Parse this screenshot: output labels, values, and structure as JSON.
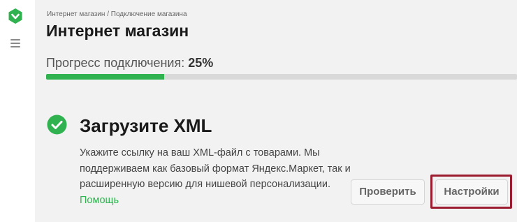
{
  "breadcrumb": "Интернет магазин / Подключение магазина",
  "page_title": "Интернет магазин",
  "progress": {
    "label": "Прогресс подключения: ",
    "value_text": "25%",
    "fraction": 0.25
  },
  "step": {
    "title": "Загрузите XML",
    "description": "Укажите ссылку на ваш XML-файл с товарами. Мы поддерживаем как базовый формат Яндекс.Маркет, так и расширенную версию для нишевой персонализации. ",
    "help_link": "Помощь"
  },
  "buttons": {
    "check": "Проверить",
    "settings": "Настройки"
  },
  "colors": {
    "accent": "#2fb24f",
    "highlight": "#9b1c2e"
  },
  "icons": {
    "logo": "brand-shield-icon",
    "menu": "hamburger-menu-icon",
    "status": "check-circle-icon"
  }
}
